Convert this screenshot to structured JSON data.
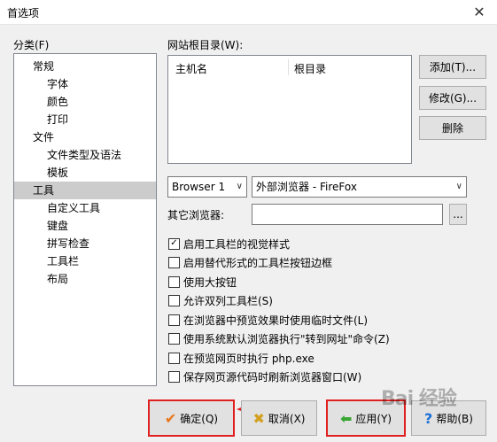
{
  "window": {
    "title": "首选项",
    "close_glyph": "✕"
  },
  "category": {
    "label": "分类(F)",
    "items": [
      {
        "label": "常规",
        "level": 0
      },
      {
        "label": "字体",
        "level": 1
      },
      {
        "label": "颜色",
        "level": 1
      },
      {
        "label": "打印",
        "level": 1
      },
      {
        "label": "文件",
        "level": 0
      },
      {
        "label": "文件类型及语法",
        "level": 1
      },
      {
        "label": "模板",
        "level": 1
      },
      {
        "label": "工具",
        "level": 0,
        "selected": true
      },
      {
        "label": "自定义工具",
        "level": 1
      },
      {
        "label": "键盘",
        "level": 1
      },
      {
        "label": "拼写检查",
        "level": 1
      },
      {
        "label": "工具栏",
        "level": 1
      },
      {
        "label": "布局",
        "level": 1
      }
    ]
  },
  "site_root": {
    "label": "网站根目录(W):",
    "columns": [
      "主机名",
      "根目录"
    ],
    "buttons": {
      "add": "添加(T)...",
      "edit": "修改(G)...",
      "delete": "删除"
    }
  },
  "browser": {
    "selected_browser": "Browser 1",
    "selected_program": "外部浏览器 - FireFox",
    "other_label": "其它浏览器:",
    "other_value": "",
    "browse_button": "..."
  },
  "options": [
    {
      "label": "启用工具栏的视觉样式",
      "checked": true
    },
    {
      "label": "启用替代形式的工具栏按钮边框",
      "checked": false
    },
    {
      "label": "使用大按钮",
      "checked": false
    },
    {
      "label": "允许双列工具栏(S)",
      "checked": false
    },
    {
      "label": "在浏览器中预览效果时使用临时文件(L)",
      "checked": false
    },
    {
      "label": "使用系统默认浏览器执行\"转到网址\"命令(Z)",
      "checked": false
    },
    {
      "label": "在预览网页时执行 php.exe",
      "checked": false
    },
    {
      "label": "保存网页源代码时刷新浏览器窗口(W)",
      "checked": false
    }
  ],
  "footer": {
    "ok": "确定(Q)",
    "cancel": "取消(X)",
    "apply": "应用(Y)",
    "help": "帮助(B)",
    "ok_icon": "✔",
    "cancel_icon": "✖",
    "apply_icon": "⬅",
    "help_icon": "?"
  },
  "colors": {
    "highlight": "#e02020",
    "selection": "#cccccc",
    "ok_icon": "#e8761a",
    "apply_icon": "#3aa634",
    "cancel_icon": "#d4a020",
    "help_icon": "#1a6fd6"
  },
  "watermark": "Bai 经验"
}
